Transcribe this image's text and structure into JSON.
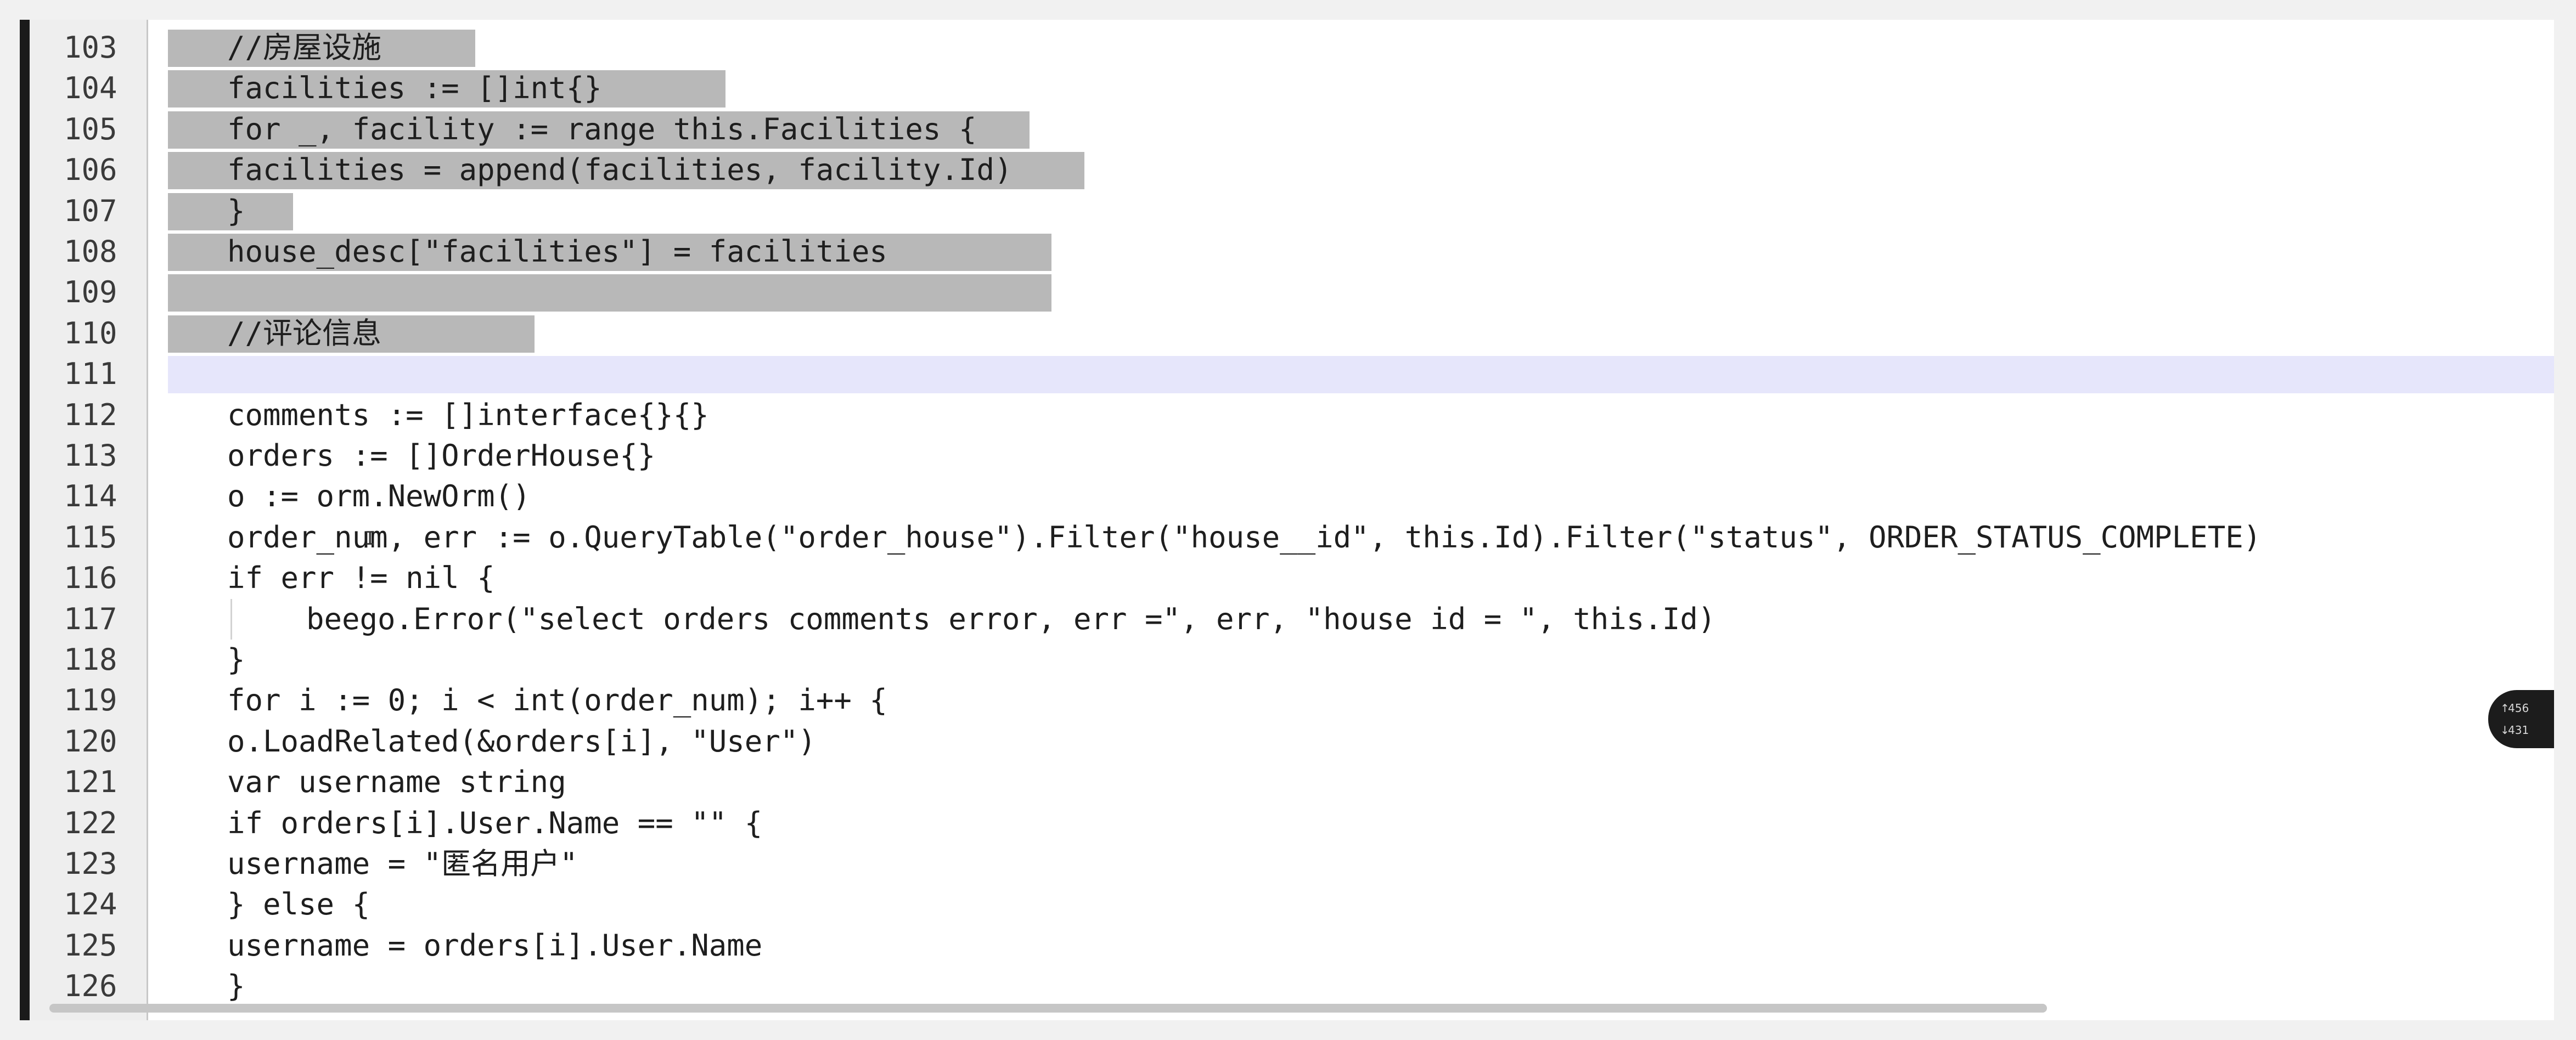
{
  "editor": {
    "lines": [
      {
        "number": "103",
        "text": "//房屋设施"
      },
      {
        "number": "104",
        "text": "facilities := []int{}"
      },
      {
        "number": "105",
        "text": "for _, facility := range this.Facilities {"
      },
      {
        "number": "106",
        "text": "facilities = append(facilities, facility.Id)"
      },
      {
        "number": "107",
        "text": "}"
      },
      {
        "number": "108",
        "text": "house_desc[\"facilities\"] = facilities"
      },
      {
        "number": "109",
        "text": ""
      },
      {
        "number": "110",
        "text": "//评论信息"
      },
      {
        "number": "111",
        "text": ""
      },
      {
        "number": "112",
        "text": "comments := []interface{}{}"
      },
      {
        "number": "113",
        "text": "orders := []OrderHouse{}"
      },
      {
        "number": "114",
        "text": "o := orm.NewOrm()"
      },
      {
        "number": "115",
        "text": "order_num, err := o.QueryTable(\"order_house\").Filter(\"house__id\", this.Id).Filter(\"status\", ORDER_STATUS_COMPLETE)"
      },
      {
        "number": "116",
        "text": "if err != nil {"
      },
      {
        "number": "117",
        "text": "beego.Error(\"select orders comments error, err =\", err, \"house id = \", this.Id)"
      },
      {
        "number": "118",
        "text": "}"
      },
      {
        "number": "119",
        "text": "for i := 0; i < int(order_num); i++ {"
      },
      {
        "number": "120",
        "text": "o.LoadRelated(&orders[i], \"User\")"
      },
      {
        "number": "121",
        "text": "var username string"
      },
      {
        "number": "122",
        "text": "if orders[i].User.Name == \"\" {"
      },
      {
        "number": "123",
        "text": "username = \"匿名用户\""
      },
      {
        "number": "124",
        "text": "} else {"
      },
      {
        "number": "125",
        "text": "username = orders[i].User.Name"
      },
      {
        "number": "126",
        "text": "}"
      }
    ]
  },
  "overlay": {
    "upload_text": "456",
    "download_text": "431"
  },
  "colors": {
    "selection": "#b8b8b8",
    "current_line": "#e6e6fb",
    "gutter": "#eeeeee",
    "text": "#1e1e1e"
  }
}
